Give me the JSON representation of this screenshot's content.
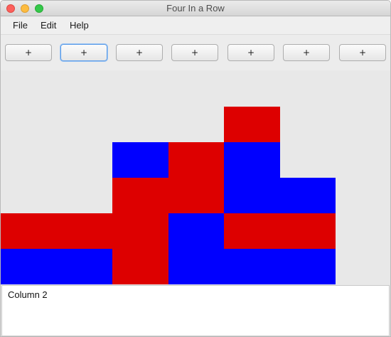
{
  "window": {
    "title": "Four In a Row"
  },
  "menu": {
    "items": [
      "File",
      "Edit",
      "Help"
    ]
  },
  "toolbar": {
    "buttons": [
      "+",
      "+",
      "+",
      "+",
      "+",
      "+",
      "+"
    ],
    "focused_index": 1
  },
  "board": {
    "colors": {
      "red": "#dd0000",
      "blue": "#0000ff",
      "empty": "#e8e8e8"
    },
    "rows": [
      [
        "empty",
        "empty",
        "empty",
        "empty",
        "empty",
        "empty",
        "empty"
      ],
      [
        "empty",
        "empty",
        "empty",
        "empty",
        "red",
        "empty",
        "empty"
      ],
      [
        "empty",
        "empty",
        "blue",
        "red",
        "blue",
        "empty",
        "empty"
      ],
      [
        "empty",
        "empty",
        "red",
        "red",
        "blue",
        "blue",
        "empty"
      ],
      [
        "red",
        "red",
        "red",
        "blue",
        "red",
        "red",
        "empty"
      ],
      [
        "blue",
        "blue",
        "red",
        "blue",
        "blue",
        "blue",
        "empty"
      ]
    ]
  },
  "status": {
    "text": "Column 2"
  }
}
